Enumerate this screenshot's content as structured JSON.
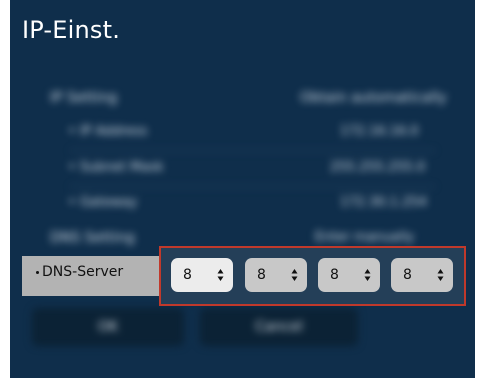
{
  "window": {
    "title": "IP-Einst."
  },
  "settings": {
    "ip_setting": {
      "label": "IP Setting",
      "value": "Obtain automatically"
    },
    "ip_address": {
      "label": "IP Address",
      "value": "172.16.16.0"
    },
    "subnet_mask": {
      "label": "Subnet Mask",
      "value": "255.255.255.0"
    },
    "gateway": {
      "label": "Gateway",
      "value": "172.30.1.254"
    },
    "dns_setting": {
      "label": "DNS Setting",
      "value": "Enter manually"
    }
  },
  "dns_server": {
    "label": "DNS-Server",
    "octets": [
      "8",
      "8",
      "8",
      "8"
    ]
  },
  "buttons": {
    "ok": "OK",
    "cancel": "Cancel"
  },
  "colors": {
    "panel_bg": "#0f2e4b",
    "highlight_border": "#c0392b",
    "row_selected_bg": "#b3b3b3"
  }
}
